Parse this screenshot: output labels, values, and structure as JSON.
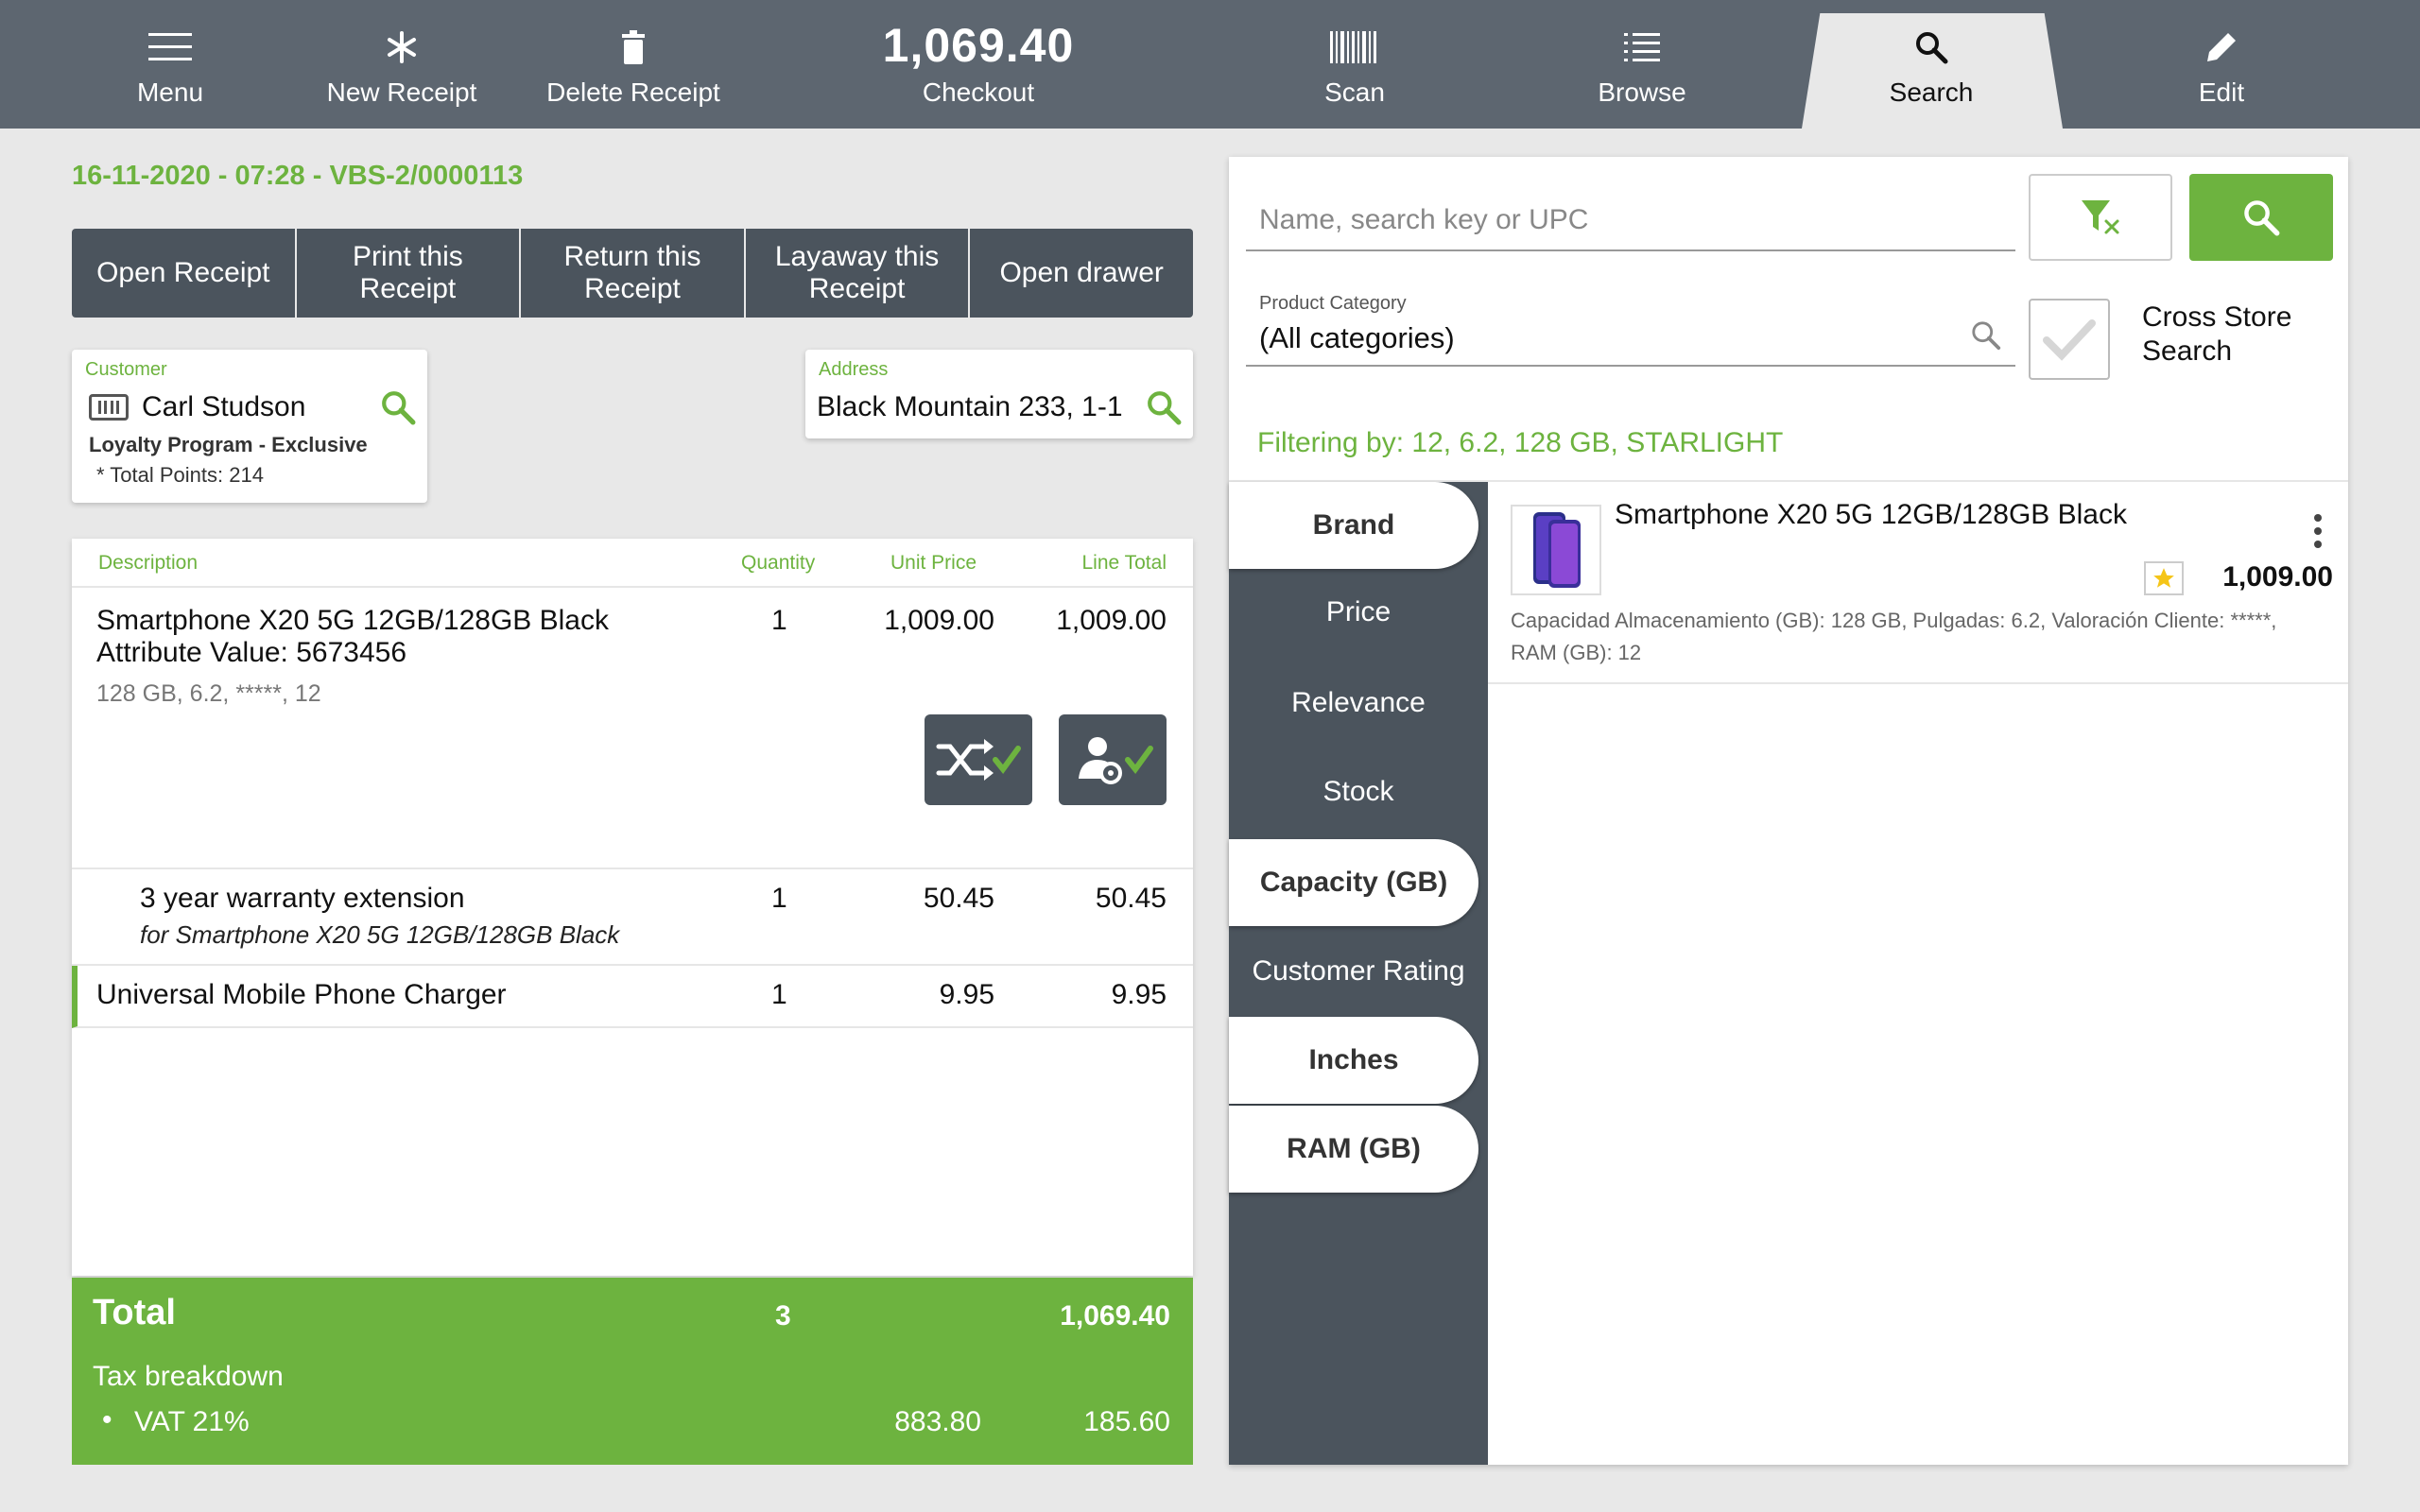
{
  "toolbar": {
    "menu": "Menu",
    "new_receipt": "New Receipt",
    "delete_receipt": "Delete Receipt",
    "checkout_amount": "1,069.40",
    "checkout": "Checkout",
    "scan": "Scan",
    "browse": "Browse",
    "search": "Search",
    "edit": "Edit"
  },
  "receipt": {
    "header": "16-11-2020 - 07:28 - VBS-2/0000113",
    "actions": [
      "Open Receipt",
      "Print this Receipt",
      "Return this Receipt",
      "Layaway this Receipt",
      "Open drawer"
    ]
  },
  "customer": {
    "caption": "Customer",
    "name": "Carl Studson",
    "loyalty": "Loyalty Program - Exclusive",
    "points": "* Total Points: 214"
  },
  "address": {
    "caption": "Address",
    "value": "Black Mountain 233, 1-1"
  },
  "lines": {
    "headers": {
      "description": "Description",
      "quantity": "Quantity",
      "unit_price": "Unit Price",
      "line_total": "Line Total"
    },
    "items": [
      {
        "description": "Smartphone X20 5G 12GB/128GB Black",
        "attribute": "Attribute Value: 5673456",
        "details": "128 GB, 6.2, *****, 12",
        "quantity": "1",
        "unit_price": "1,009.00",
        "line_total": "1,009.00"
      },
      {
        "description": "3 year warranty extension",
        "for": "for Smartphone X20 5G 12GB/128GB Black",
        "quantity": "1",
        "unit_price": "50.45",
        "line_total": "50.45"
      },
      {
        "description": "Universal Mobile Phone Charger",
        "quantity": "1",
        "unit_price": "9.95",
        "line_total": "9.95"
      }
    ]
  },
  "totals": {
    "label": "Total",
    "quantity": "3",
    "amount": "1,069.40",
    "tax_label": "Tax breakdown",
    "vat_label": "VAT 21%",
    "vat_net": "883.80",
    "vat_amount": "185.60"
  },
  "search": {
    "placeholder": "Name, search key or UPC",
    "category_caption": "Product Category",
    "category_value": "(All categories)",
    "cross_store": "Cross Store Search",
    "filtering": "Filtering by: 12, 6.2, 128 GB, STARLIGHT",
    "facets": [
      "Brand",
      "Price",
      "Relevance",
      "Stock",
      "Capacity (GB)",
      "Customer Rating",
      "Inches",
      "RAM (GB)"
    ],
    "result": {
      "name": "Smartphone X20 5G 12GB/128GB Black",
      "price": "1,009.00",
      "attributes": "Capacidad Almacenamiento (GB): 128 GB, Pulgadas: 6.2, Valoración Cliente: *****, RAM (GB): 12"
    }
  },
  "colors": {
    "accent": "#6db33f",
    "toolbar": "#5d6670",
    "dark": "#4b545d"
  }
}
